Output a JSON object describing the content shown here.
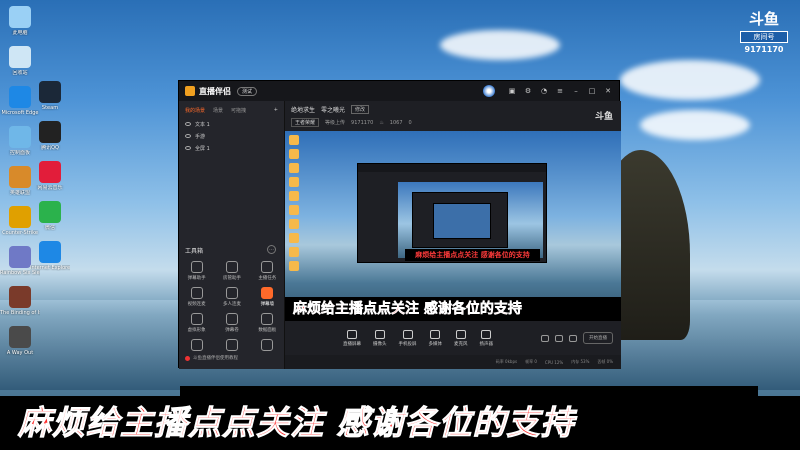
{
  "watermark": {
    "logo_text": "斗鱼",
    "room_label": "房间号",
    "room_number": "9171170"
  },
  "desktop_icons": [
    {
      "label": "此电脑",
      "icon": "computer-icon",
      "color": "#9ad0f5"
    },
    {
      "label": "回收站",
      "icon": "recycle-bin-icon",
      "color": "#cfe6f5"
    },
    {
      "label": "Microsoft Edge",
      "icon": "edge-icon",
      "color": "#1e88e5"
    },
    {
      "label": "控制面板",
      "icon": "control-panel-icon",
      "color": "#6fb7e8"
    },
    {
      "label": "英雄联盟",
      "icon": "game-icon",
      "color": "#d88a2a"
    },
    {
      "label": "Counter-Strike",
      "icon": "csgo-icon",
      "color": "#e0a000"
    },
    {
      "label": "Rainbow Six Siege",
      "icon": "game-icon",
      "color": "#6f79c6"
    },
    {
      "label": "The Binding of Isaac",
      "icon": "game-icon",
      "color": "#7a3a2a"
    },
    {
      "label": "A Way Out",
      "icon": "game-icon",
      "color": "#4a4a4a"
    },
    {
      "label": "Steam",
      "icon": "steam-icon",
      "color": "#1b2838"
    },
    {
      "label": "腾讯QQ",
      "icon": "qq-icon",
      "color": "#222222"
    },
    {
      "label": "网易云音乐",
      "icon": "music-icon",
      "color": "#e21d3a"
    },
    {
      "label": "微信",
      "icon": "wechat-icon",
      "color": "#2bb24c"
    },
    {
      "label": "Internet Explorer",
      "icon": "ie-icon",
      "color": "#1e88e5"
    }
  ],
  "app": {
    "title": "直播伴侣",
    "version": "测试",
    "side_tabs": [
      "我的场景",
      "场景",
      "可拖拽"
    ],
    "sources": [
      "文本 1",
      "手游",
      "全屏 1"
    ],
    "tools_title": "工具箱",
    "tools": [
      {
        "label": "弹幕助手",
        "icon": "danmu-icon",
        "highlight": false
      },
      {
        "label": "房管助手",
        "icon": "admin-icon",
        "highlight": false
      },
      {
        "label": "主播任务",
        "icon": "task-icon",
        "highlight": false
      },
      {
        "label": "视频连麦",
        "icon": "video-icon",
        "highlight": false
      },
      {
        "label": "多人连麦",
        "icon": "multi-mic-icon",
        "highlight": false
      },
      {
        "label": "弹幕墙",
        "icon": "wall-icon",
        "highlight": true
      },
      {
        "label": "虚拟形象",
        "icon": "avatar-icon",
        "highlight": false
      },
      {
        "label": "弹幕卷",
        "icon": "scroll-icon",
        "highlight": false
      },
      {
        "label": "数据面板",
        "icon": "data-icon",
        "highlight": false
      },
      {
        "label": "",
        "icon": "plugin-icon",
        "highlight": false
      },
      {
        "label": "",
        "icon": "plugin-icon",
        "highlight": false
      },
      {
        "label": "",
        "icon": "network-icon",
        "highlight": false
      }
    ],
    "footer": "斗鱼直播伴侣使用教程",
    "stream": {
      "name": "绝地求生",
      "room_label": "零之曦光",
      "edit": "修改",
      "category": "王者荣耀",
      "tag": "等级上传",
      "uid": "9171170",
      "hot": "1067",
      "followers": "0"
    },
    "preview_banner": "麻烦给主播点点关注  感谢各位的支持",
    "controls": [
      {
        "label": "直播屏幕",
        "icon": "screen-icon"
      },
      {
        "label": "摄像头",
        "icon": "camera-icon"
      },
      {
        "label": "手机投屏",
        "icon": "phone-cast-icon"
      },
      {
        "label": "多媒体",
        "icon": "media-icon"
      },
      {
        "label": "麦克风",
        "icon": "mic-icon"
      },
      {
        "label": "扬声器",
        "icon": "speaker-icon"
      }
    ],
    "start_button": "开始直播",
    "status": [
      "码率 0kbps",
      "帧率 0",
      "CPU 12%",
      "内存 53%",
      "丢帧 0%"
    ]
  },
  "bottom_banner": "麻烦给主播点点关注   感谢各位的支持"
}
